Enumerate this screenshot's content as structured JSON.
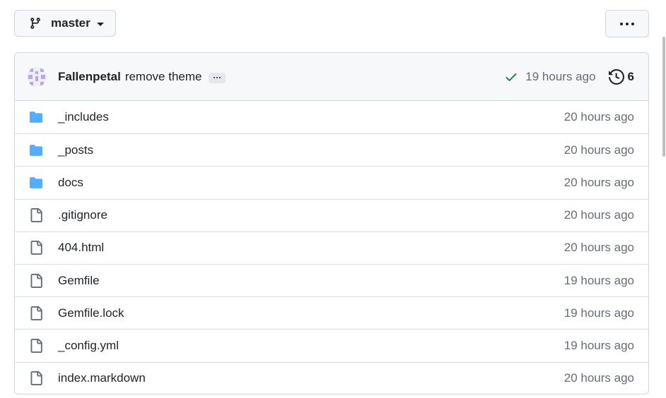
{
  "branch": {
    "name": "master",
    "icon": "git-branch-icon"
  },
  "more_menu": {
    "icon": "kebab-horizontal-icon"
  },
  "commit": {
    "author": "Fallenpetal",
    "message": "remove theme",
    "status_icon": "check-icon",
    "status_color": "#1a7f37",
    "time": "19 hours ago",
    "history_count": "6",
    "history_icon": "history-icon"
  },
  "files": [
    {
      "type": "folder",
      "name": "_includes",
      "time": "20 hours ago"
    },
    {
      "type": "folder",
      "name": "_posts",
      "time": "20 hours ago"
    },
    {
      "type": "folder",
      "name": "docs",
      "time": "20 hours ago"
    },
    {
      "type": "file",
      "name": ".gitignore",
      "time": "20 hours ago"
    },
    {
      "type": "file",
      "name": "404.html",
      "time": "20 hours ago"
    },
    {
      "type": "file",
      "name": "Gemfile",
      "time": "19 hours ago"
    },
    {
      "type": "file",
      "name": "Gemfile.lock",
      "time": "19 hours ago"
    },
    {
      "type": "file",
      "name": "_config.yml",
      "time": "19 hours ago"
    },
    {
      "type": "file",
      "name": "index.markdown",
      "time": "20 hours ago"
    }
  ],
  "colors": {
    "folder": "#54aeff",
    "file_icon": "#656d76",
    "muted": "#656d76",
    "border": "#d0d7de"
  }
}
